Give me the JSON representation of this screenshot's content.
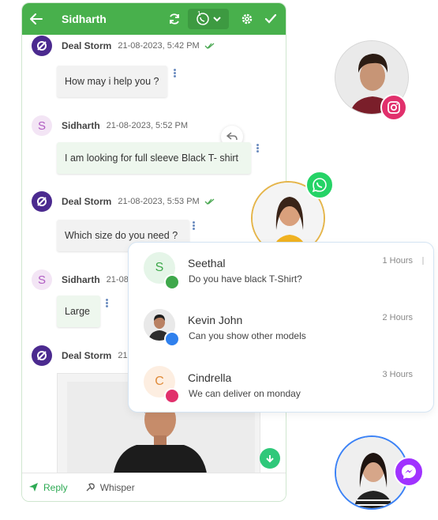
{
  "header": {
    "title": "Sidharth",
    "channel_count": "1"
  },
  "messages": [
    {
      "sender": "Deal Storm",
      "time": "21-08-2023, 5:42 PM",
      "text": "How may i help you ?"
    },
    {
      "sender": "Sidharth",
      "initial": "S",
      "time": "21-08-2023, 5:52 PM",
      "text": "I am looking for full sleeve Black T- shirt"
    },
    {
      "sender": "Deal Storm",
      "time": "21-08-2023, 5:53 PM",
      "text": "Which size do you need ?"
    },
    {
      "sender": "Sidharth",
      "initial": "S",
      "time": "21-08",
      "text": "Large"
    },
    {
      "sender": "Deal Storm",
      "time": "21"
    }
  ],
  "reply_bar": {
    "reply_label": "Reply",
    "whisper_label": "Whisper"
  },
  "conversations": [
    {
      "initial": "S",
      "name": "Seethal",
      "message": "Do you have black T-Shirt?",
      "time": "1 Hours",
      "channel": "whatsapp-business-icon"
    },
    {
      "name": "Kevin John",
      "message": "Can you show other models",
      "time": "2 Hours",
      "channel": "messenger-icon"
    },
    {
      "initial": "C",
      "name": "Cindrella",
      "message": "We can deliver on monday",
      "time": "3 Hours",
      "channel": "instagram-icon"
    }
  ],
  "colors": {
    "header_green": "#48b04c",
    "ds_purple": "#4b2a8f",
    "whatsapp": "#25d366",
    "messenger": "#a033ff",
    "instagram": "#e1306c"
  }
}
